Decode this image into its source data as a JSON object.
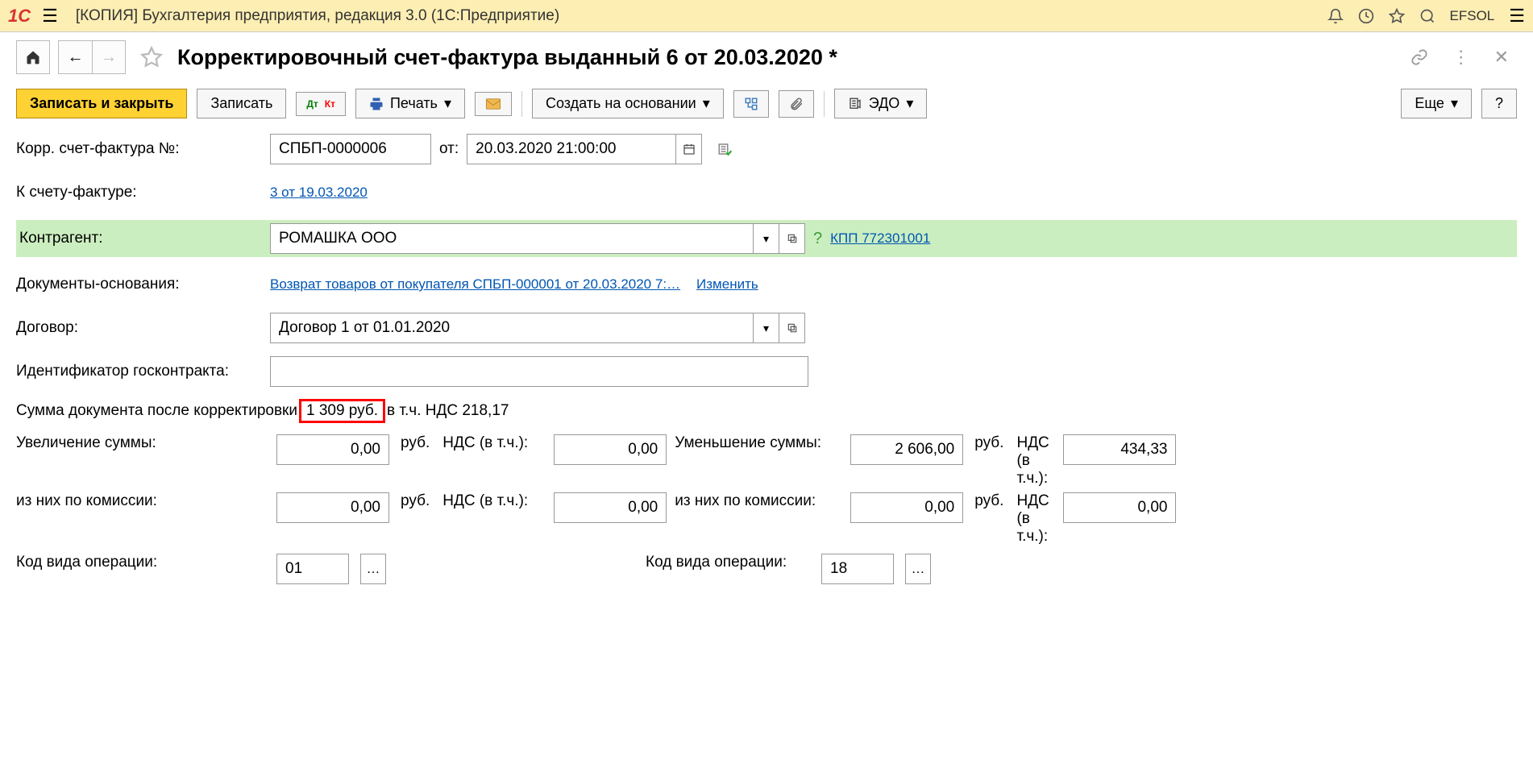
{
  "topbar": {
    "app_title": "[КОПИЯ] Бухгалтерия предприятия, редакция 3.0   (1С:Предприятие)",
    "user": "EFSOL"
  },
  "page": {
    "title": "Корректировочный счет-фактура выданный 6 от 20.03.2020 *"
  },
  "toolbar": {
    "write_close": "Записать и закрыть",
    "write": "Записать",
    "print": "Печать",
    "create_based": "Создать на основании",
    "edo": "ЭДО",
    "more": "Еще",
    "help": "?"
  },
  "form": {
    "corr_num_label": "Корр. счет-фактура №:",
    "corr_num_value": "СПБП-0000006",
    "from_label": "от:",
    "date_value": "20.03.2020 21:00:00",
    "to_invoice_label": "К счету-фактуре:",
    "to_invoice_link": "3 от 19.03.2020",
    "counterparty_label": "Контрагент:",
    "counterparty_value": "РОМАШКА ООО",
    "kpp_link": "КПП 772301001",
    "basis_docs_label": "Документы-основания:",
    "basis_docs_link": "Возврат товаров от покупателя СПБП-000001 от 20.03.2020 7:…",
    "basis_change": "Изменить",
    "contract_label": "Договор:",
    "contract_value": "Договор 1 от 01.01.2020",
    "gov_id_label": "Идентификатор госконтракта:",
    "gov_id_value": "",
    "sum_prefix": "Сумма документа после корректировки",
    "sum_value": "1 309 руб.",
    "sum_suffix": "в т.ч. НДС 218,17"
  },
  "amounts": {
    "increase_label": "Увеличение суммы:",
    "increase_value": "0,00",
    "rub": "руб.",
    "vat_label": "НДС (в т.ч.):",
    "vat_label_multi": "НДС (в т.ч.):",
    "increase_vat_value": "0,00",
    "decrease_label": "Уменьшение суммы:",
    "decrease_value": "2 606,00",
    "decrease_vat_value": "434,33",
    "commission_label": "из них по комиссии:",
    "commission_value1": "0,00",
    "commission_vat1": "0,00",
    "commission_value2": "0,00",
    "commission_vat2": "0,00",
    "op_code_label": "Код вида операции:",
    "op_code1": "01",
    "op_code2": "18"
  }
}
